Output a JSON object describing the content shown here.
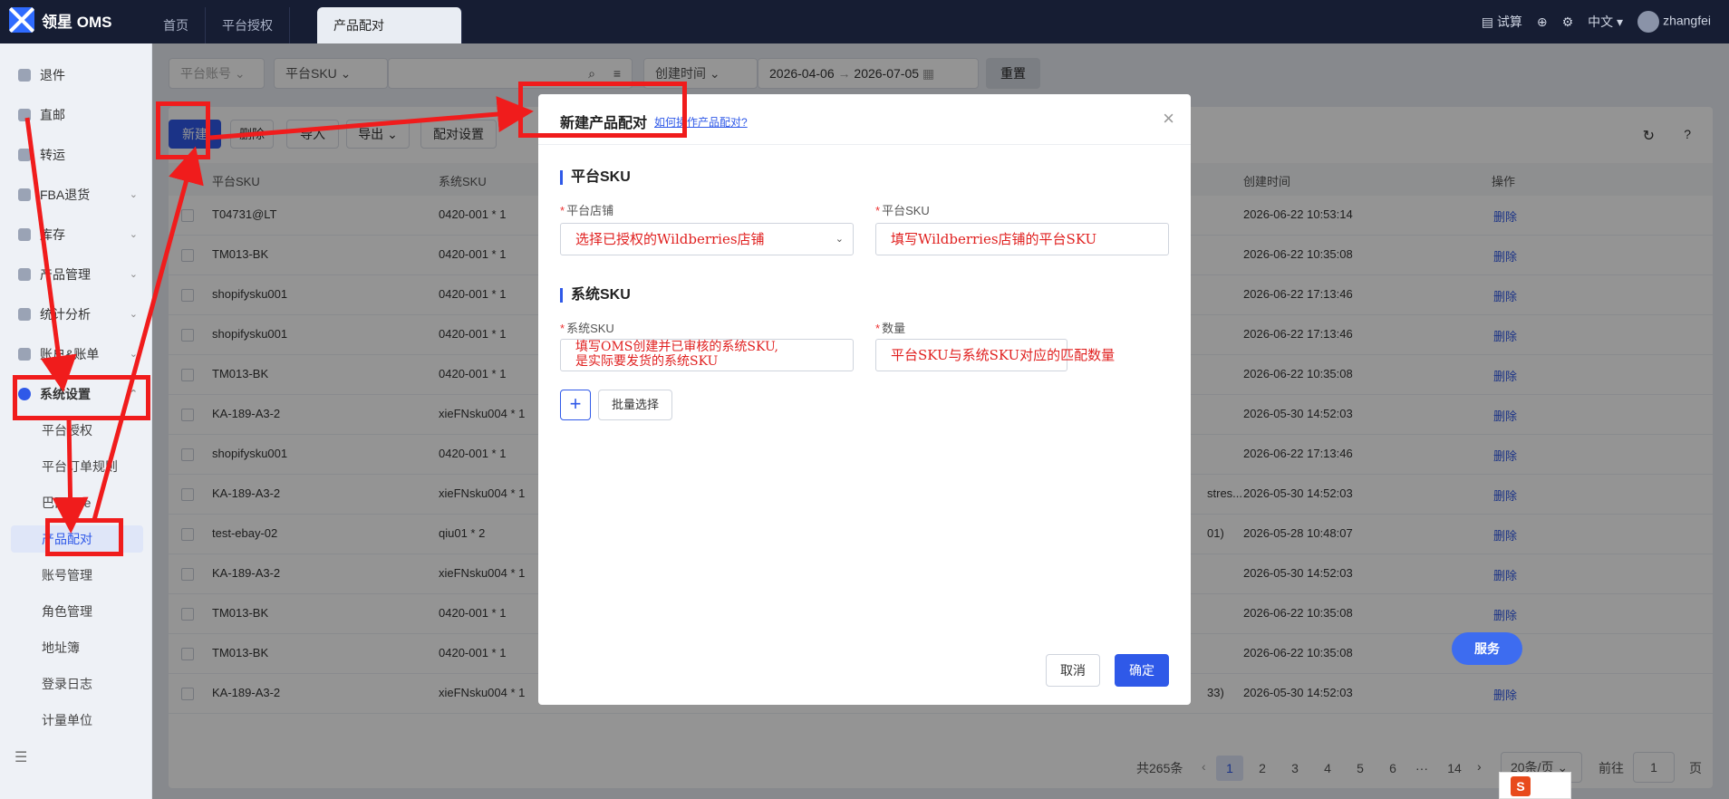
{
  "app": {
    "title": "领星 OMS"
  },
  "top_tabs": [
    {
      "label": "首页"
    },
    {
      "label": "平台授权"
    },
    {
      "label": "产品配对"
    }
  ],
  "top_right": {
    "trial": "试算",
    "lang": "中文",
    "user": "zhangfei"
  },
  "sidebar": {
    "items": [
      {
        "label": "退件"
      },
      {
        "label": "直邮"
      },
      {
        "label": "转运"
      },
      {
        "label": "FBA退货"
      },
      {
        "label": "库存"
      },
      {
        "label": "产品管理"
      },
      {
        "label": "统计分析"
      },
      {
        "label": "账户&账单"
      },
      {
        "label": "系统设置"
      }
    ],
    "subitems": [
      {
        "label": "平台授权"
      },
      {
        "label": "平台订单规则"
      },
      {
        "label": "巴西NFe"
      },
      {
        "label": "产品配对"
      },
      {
        "label": "账号管理"
      },
      {
        "label": "角色管理"
      },
      {
        "label": "地址簿"
      },
      {
        "label": "登录日志"
      },
      {
        "label": "计量单位"
      }
    ]
  },
  "filter": {
    "account_placeholder": "平台账号",
    "sku_type": "平台SKU",
    "time_type": "创建时间",
    "date_start": "2026-04-06",
    "date_sep": "→",
    "date_end": "2026-07-05",
    "reset": "重置"
  },
  "toolbar": {
    "new": "新建",
    "delete": "删除",
    "import": "导入",
    "export": "导出",
    "settings": "配对设置"
  },
  "table": {
    "headers": {
      "platform_sku": "平台SKU",
      "system_sku": "系统SKU",
      "created": "创建时间",
      "ops": "操作"
    },
    "delete_label": "删除",
    "rows": [
      {
        "psku": "T04731@LT",
        "ssku": "0420-001 * 1",
        "extra": "",
        "time": "2026-06-22 10:53:14"
      },
      {
        "psku": "TM013-BK",
        "ssku": "0420-001 * 1",
        "extra": "",
        "time": "2026-06-22 10:35:08"
      },
      {
        "psku": "shopifysku001",
        "ssku": "0420-001 * 1",
        "extra": "",
        "time": "2026-06-22 17:13:46"
      },
      {
        "psku": "shopifysku001",
        "ssku": "0420-001 * 1",
        "extra": "",
        "time": "2026-06-22 17:13:46"
      },
      {
        "psku": "TM013-BK",
        "ssku": "0420-001 * 1",
        "extra": "",
        "time": "2026-06-22 10:35:08"
      },
      {
        "psku": "KA-189-A3-2",
        "ssku": "xieFNsku004 * 1",
        "extra": "",
        "time": "2026-05-30 14:52:03"
      },
      {
        "psku": "shopifysku001",
        "ssku": "0420-001 * 1",
        "extra": "",
        "time": "2026-06-22 17:13:46"
      },
      {
        "psku": "KA-189-A3-2",
        "ssku": "xieFNsku004 * 1",
        "extra": "stres...",
        "time": "2026-05-30 14:52:03"
      },
      {
        "psku": "test-ebay-02",
        "ssku": "qiu01 * 2",
        "extra": "01)",
        "time": "2026-05-28 10:48:07"
      },
      {
        "psku": "KA-189-A3-2",
        "ssku": "xieFNsku004 * 1",
        "extra": "",
        "time": "2026-05-30 14:52:03"
      },
      {
        "psku": "TM013-BK",
        "ssku": "0420-001 * 1",
        "extra": "",
        "time": "2026-06-22 10:35:08"
      },
      {
        "psku": "TM013-BK",
        "ssku": "0420-001 * 1",
        "extra": "",
        "time": "2026-06-22 10:35:08"
      },
      {
        "psku": "KA-189-A3-2",
        "ssku": "xieFNsku004 * 1",
        "extra": "33)",
        "time": "2026-05-30 14:52:03"
      }
    ]
  },
  "pager": {
    "total": "共265条",
    "pages": [
      "1",
      "2",
      "3",
      "4",
      "5",
      "6",
      "···",
      "14"
    ],
    "page_size": "20条/页",
    "goto": "前往",
    "goto_value": "1",
    "page_unit": "页"
  },
  "modal": {
    "title": "新建产品配对",
    "help_link": "如何操作产品配对?",
    "section1": "平台SKU",
    "shop_label": "平台店铺",
    "shop_value": "选择已授权的Wildberries店铺",
    "psku_label": "平台SKU",
    "psku_value": "填写Wildberries店铺的平台SKU",
    "section2": "系统SKU",
    "ssku_label": "系统SKU",
    "ssku_line1": "填写OMS创建并已审核的系统SKU,",
    "ssku_line2": "是实际要发货的系统SKU",
    "qty_label": "数量",
    "qty_value": "平台SKU与系统SKU对应的匹配数量",
    "plus": "+",
    "batch": "批量选择",
    "cancel": "取消",
    "ok": "确定",
    "required_mark": "*",
    "close": "×"
  },
  "service_button": "服务",
  "corner_badge": "S",
  "colors": {
    "primary": "#2f59e8",
    "annotation_red": "#f01c1c",
    "topbar": "#161d33"
  }
}
